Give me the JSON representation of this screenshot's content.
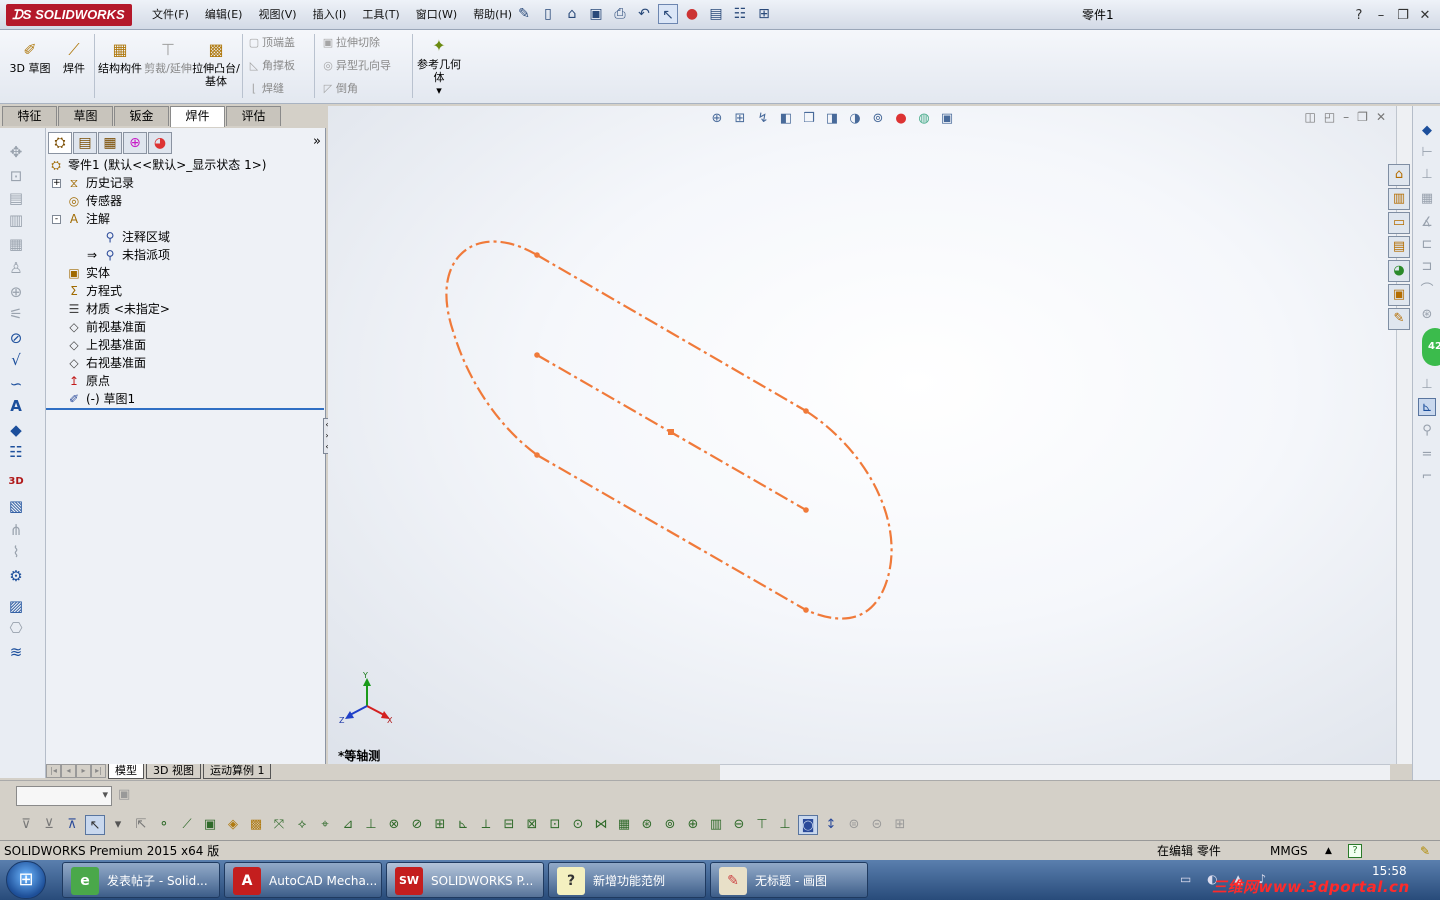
{
  "app": {
    "logo_text": "SOLIDWORKS",
    "document_title": "零件1"
  },
  "menu": [
    "文件(F)",
    "编辑(E)",
    "视图(V)",
    "插入(I)",
    "工具(T)",
    "窗口(W)",
    "帮助(H)"
  ],
  "ribbon": {
    "sketch3d_label": "3D 草图",
    "weldment_label": "焊件",
    "structural_label": "结构构件",
    "trim_label": "剪裁/延伸",
    "extrude_label": "拉伸凸台/基体",
    "endcap_label": "顶端盖",
    "gusset_label": "角撑板",
    "weldbead_label": "焊缝",
    "extcut_label": "拉伸切除",
    "hole_label": "异型孔向导",
    "chamfer_label": "倒角",
    "refgeom_label": "参考几何体"
  },
  "command_tabs": [
    {
      "label": "特征",
      "active": false
    },
    {
      "label": "草图",
      "active": false
    },
    {
      "label": "钣金",
      "active": false
    },
    {
      "label": "焊件",
      "active": true
    },
    {
      "label": "评估",
      "active": false
    }
  ],
  "tree": {
    "root": "零件1  (默认<<默认>_显示状态 1>)",
    "items": [
      {
        "label": "历史记录",
        "icon": "history-icon",
        "indent": 1,
        "toggle": "+"
      },
      {
        "label": "传感器",
        "icon": "sensor-icon",
        "indent": 1,
        "toggle": ""
      },
      {
        "label": "注解",
        "icon": "annotation-icon",
        "indent": 1,
        "toggle": "-"
      },
      {
        "label": "注释区域",
        "icon": "note-area-icon",
        "indent": 2,
        "toggle": ""
      },
      {
        "label": "未指派项",
        "icon": "unassigned-icon",
        "indent": 2,
        "toggle": ""
      },
      {
        "label": "实体",
        "icon": "solid-body-icon",
        "indent": 1,
        "toggle": ""
      },
      {
        "label": "方程式",
        "icon": "equation-icon",
        "indent": 1,
        "toggle": ""
      },
      {
        "label": "材质 <未指定>",
        "icon": "material-icon",
        "indent": 1,
        "toggle": ""
      },
      {
        "label": "前视基准面",
        "icon": "plane-icon",
        "indent": 1,
        "toggle": ""
      },
      {
        "label": "上视基准面",
        "icon": "plane-icon",
        "indent": 1,
        "toggle": ""
      },
      {
        "label": "右视基准面",
        "icon": "plane-icon",
        "indent": 1,
        "toggle": ""
      },
      {
        "label": "原点",
        "icon": "origin-icon",
        "indent": 1,
        "toggle": ""
      },
      {
        "label": "(-) 草图1",
        "icon": "sketch-icon",
        "indent": 1,
        "toggle": ""
      }
    ]
  },
  "bottom_tabs": [
    {
      "label": "模型",
      "active": true
    },
    {
      "label": "3D 视图",
      "active": false
    },
    {
      "label": "运动算例 1",
      "active": false
    }
  ],
  "viewport": {
    "view_label": "*等轴测",
    "sketch_color": "#f07a3a",
    "triad": {
      "x": "X",
      "y": "Y",
      "z": "Z"
    }
  },
  "right_badge": "42",
  "status": {
    "product": "SOLIDWORKS Premium 2015 x64 版",
    "mode": "在编辑 零件",
    "units": "MMGS",
    "units_arrow": "▲",
    "help": "?"
  },
  "taskbar": {
    "start_icon": "windows-logo-icon",
    "apps": [
      {
        "label": "发表帖子 - Solid...",
        "active": false
      },
      {
        "label": "AutoCAD Mecha...",
        "active": false
      },
      {
        "label": "SOLIDWORKS P...",
        "active": true
      },
      {
        "label": "新增功能范例",
        "active": false
      },
      {
        "label": "无标题 - 画图",
        "active": false
      }
    ],
    "clock": "15:58",
    "watermark": "三维网www.3dportal.cn"
  }
}
